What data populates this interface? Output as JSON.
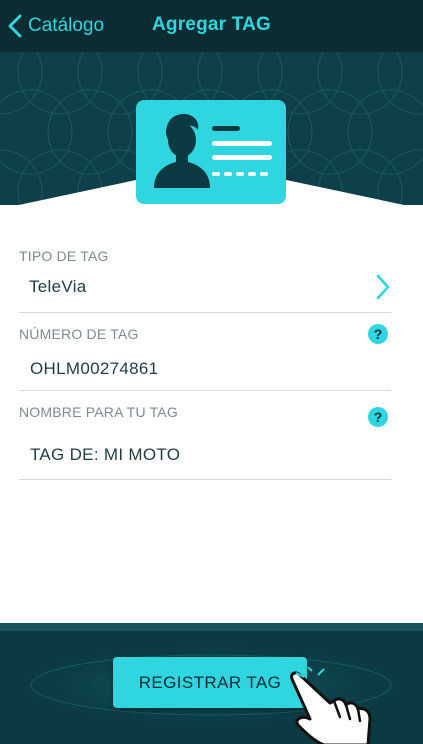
{
  "navbar": {
    "back_label": "Catálogo",
    "title": "Agregar TAG"
  },
  "form": {
    "tag_type": {
      "label": "TIPO DE TAG",
      "value": "TeleVia"
    },
    "tag_number": {
      "label": "NÚMERO DE TAG",
      "value": "OHLM00274861",
      "help": "?"
    },
    "tag_name": {
      "label": "NOMBRE PARA TU TAG",
      "value": "TAG DE: MI MOTO",
      "help": "?"
    }
  },
  "footer": {
    "register_label": "REGISTRAR TAG"
  },
  "colors": {
    "accent": "#2fd6e0",
    "navbar_bg": "#0b2c33",
    "header_bg": "#0e4049",
    "text_dark": "#1d3d45",
    "label_gray": "#7e8a91"
  },
  "icons": [
    "chevron-left-icon",
    "id-card-icon",
    "chevron-right-icon",
    "help-icon",
    "pointing-hand-icon"
  ]
}
